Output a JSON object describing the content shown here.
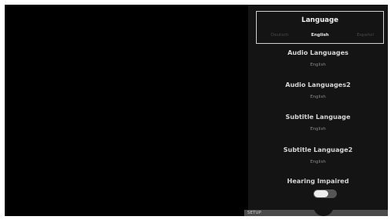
{
  "language": {
    "title": "Language",
    "prev_option": "Deutsch",
    "selected": "English",
    "next_option": "Español"
  },
  "settings": [
    {
      "label": "Audio Languages",
      "value": "English"
    },
    {
      "label": "Audio Languages2",
      "value": "English"
    },
    {
      "label": "Subtitle Language",
      "value": "English"
    },
    {
      "label": "Subtitle Language2",
      "value": "English"
    }
  ],
  "hearing_impaired": {
    "label": "Hearing Impaired",
    "state": "off"
  },
  "footer": {
    "label": "SETUP"
  }
}
